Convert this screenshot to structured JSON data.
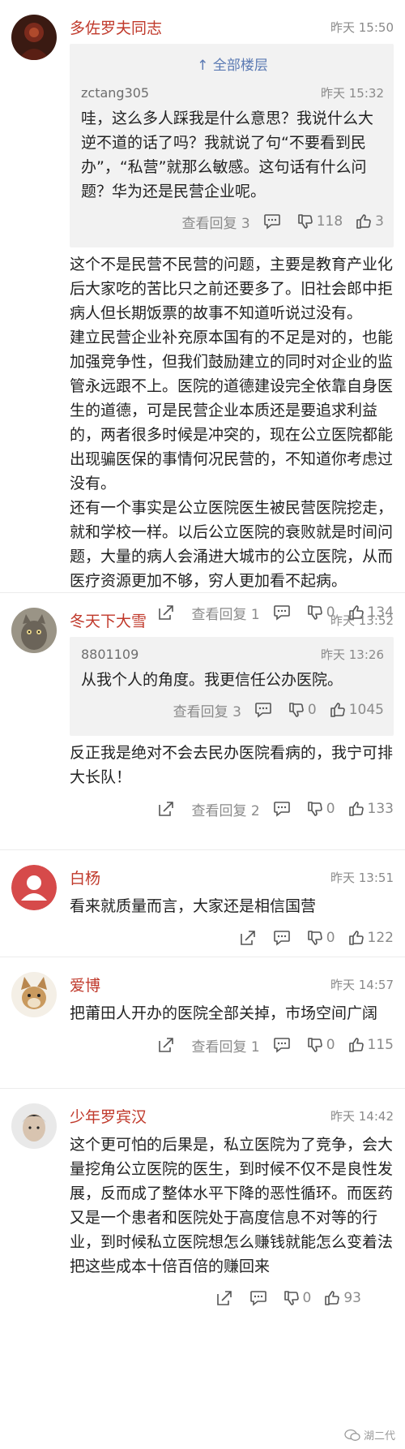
{
  "comments": [
    {
      "username": "多佐罗夫同志",
      "time": "昨天 15:50",
      "quote": {
        "all_floors": "↑ 全部楼层",
        "user": "zctang305",
        "time": "昨天 15:32",
        "text": "哇，这么多人踩我是什么意思？我说什么大逆不道的话了吗？我就说了句“不要看到民办”，“私营”就那么敏感。这句话有什么问题？华为还是民营企业呢。",
        "reply_label": "查看回复 3",
        "down_count": "118",
        "up_count": "3"
      },
      "text": "这个不是民营不民营的问题，主要是教育产业化后大家吃的苦比只之前还要多了。旧社会郎中拒病人但长期饭票的故事不知道听说过没有。\n建立民营企业补充原本国有的不足是对的，也能加强竞争性，但我们鼓励建立的同时对企业的监管永远跟不上。医院的道德建设完全依靠自身医生的道德，可是民营企业本质还是要追求利益的，两者很多时候是冲突的，现在公立医院都能出现骗医保的事情何况民营的，不知道你考虑过没有。\n还有一个事实是公立医院医生被民营医院挖走，就和学校一样。以后公立医院的衰败就是时间问题，大量的病人会涌进大城市的公立医院，从而医疗资源更加不够，穷人更加看不起病。",
      "reply_label": "查看回复 1",
      "down_count": "0",
      "up_count": "134"
    },
    {
      "username": "冬天下大雪",
      "time": "昨天 13:52",
      "quote": {
        "user": "8801109",
        "time": "昨天 13:26",
        "text": "从我个人的角度。我更信任公办医院。",
        "reply_label": "查看回复 3",
        "down_count": "0",
        "up_count": "1045"
      },
      "text": "反正我是绝对不会去民办医院看病的，我宁可排大长队！",
      "reply_label": "查看回复 2",
      "down_count": "0",
      "up_count": "133"
    },
    {
      "username": "白杨",
      "time": "昨天 13:51",
      "text": "看来就质量而言，大家还是相信国营",
      "down_count": "0",
      "up_count": "122"
    },
    {
      "username": "爱博",
      "time": "昨天 14:57",
      "text": "把莆田人开办的医院全部关掉，市场空间广阔",
      "reply_label": "查看回复 1",
      "down_count": "0",
      "up_count": "115"
    },
    {
      "username": "少年罗宾汉",
      "time": "昨天 14:42",
      "text": "这个更可怕的后果是，私立医院为了竞争，会大量挖角公立医院的医生，到时候不仅不是良性发展，反而成了整体水平下降的恶性循环。而医药又是一个患者和医院处于高度信息不对等的行业，到时候私立医院想怎么赚钱就能怎么变着法把这些成本十倍百倍的赚回来",
      "down_count": "0",
      "up_count": "93"
    }
  ],
  "watermark": "湖二代",
  "colors": {
    "username": "#c0392b",
    "link": "#5b7ab3",
    "meta": "#8a8a8a",
    "quote_bg": "#f2f2f2"
  }
}
